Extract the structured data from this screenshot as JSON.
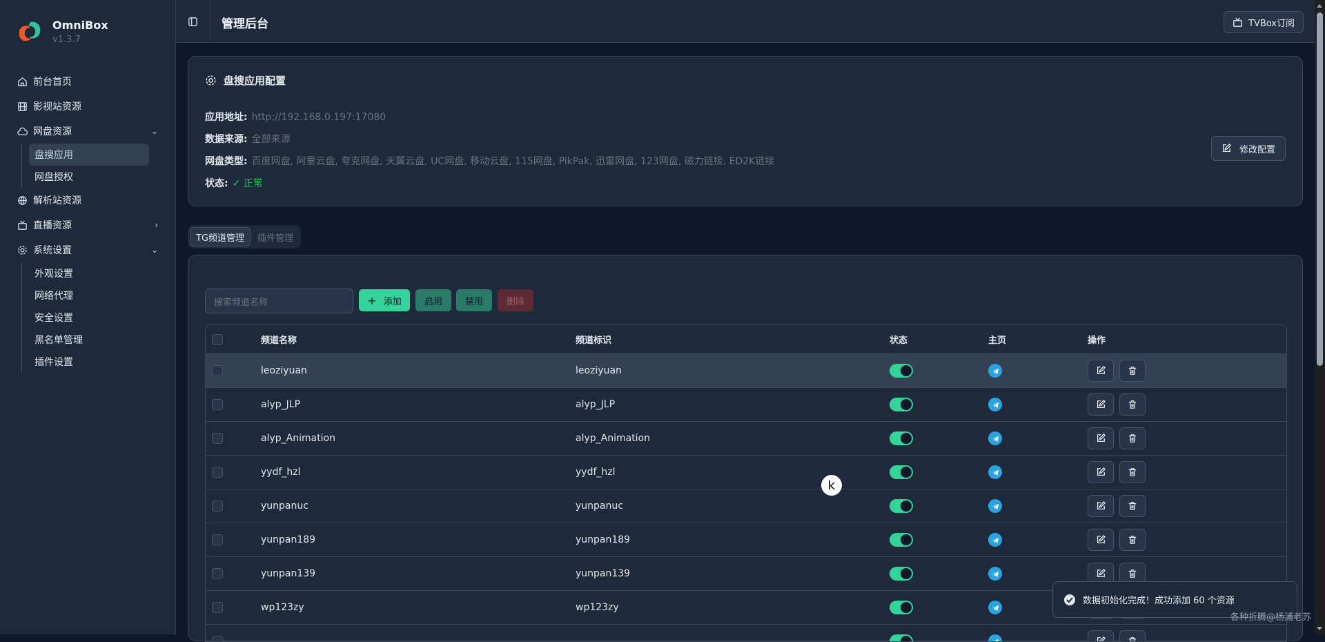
{
  "app": {
    "name": "OmniBox",
    "version": "v1.3.7"
  },
  "sidebar": {
    "items": [
      {
        "label": "前台首页",
        "icon": "home-icon"
      },
      {
        "label": "影视站资源",
        "icon": "film-icon"
      },
      {
        "label": "网盘资源",
        "icon": "cloud-icon",
        "children": [
          {
            "label": "盘搜应用",
            "active": true
          },
          {
            "label": "网盘授权"
          }
        ]
      },
      {
        "label": "解析站资源",
        "icon": "globe-icon"
      },
      {
        "label": "直播资源",
        "icon": "tv-icon"
      },
      {
        "label": "系统设置",
        "icon": "gear-icon",
        "children": [
          {
            "label": "外观设置"
          },
          {
            "label": "网络代理"
          },
          {
            "label": "安全设置"
          },
          {
            "label": "黑名单管理"
          },
          {
            "label": "插件设置"
          }
        ]
      }
    ]
  },
  "header": {
    "title": "管理后台",
    "tvbox_label": "TVBox订阅"
  },
  "config": {
    "title": "盘搜应用配置",
    "address_label": "应用地址:",
    "address": "http://192.168.0.197:17080",
    "source_label": "数据来源:",
    "source": "全部来源",
    "types_label": "网盘类型:",
    "types": "百度网盘, 阿里云盘, 夸克网盘, 天翼云盘, UC网盘, 移动云盘, 115网盘, PikPak, 迅雷网盘, 123网盘, 磁力链接, ED2K链接",
    "status_label": "状态:",
    "status": "正常",
    "edit_label": "修改配置"
  },
  "tabs": [
    {
      "label": "TG频道管理",
      "active": true
    },
    {
      "label": "插件管理"
    }
  ],
  "toolbar": {
    "search_placeholder": "搜索频道名称",
    "add": "添加",
    "enable": "启用",
    "disable": "禁用",
    "delete": "删除"
  },
  "table": {
    "columns": [
      "频道名称",
      "频道标识",
      "状态",
      "主页",
      "操作"
    ],
    "rows": [
      {
        "name": "leoziyuan",
        "id": "leoziyuan",
        "enabled": true
      },
      {
        "name": "alyp_JLP",
        "id": "alyp_JLP",
        "enabled": true
      },
      {
        "name": "alyp_Animation",
        "id": "alyp_Animation",
        "enabled": true
      },
      {
        "name": "yydf_hzl",
        "id": "yydf_hzl",
        "enabled": true
      },
      {
        "name": "yunpanuc",
        "id": "yunpanuc",
        "enabled": true
      },
      {
        "name": "yunpan189",
        "id": "yunpan189",
        "enabled": true
      },
      {
        "name": "yunpan139",
        "id": "yunpan139",
        "enabled": true
      },
      {
        "name": "wp123zy",
        "id": "wp123zy",
        "enabled": true
      },
      {
        "name": "",
        "id": "",
        "enabled": true
      }
    ]
  },
  "toast": "数据初始化完成！成功添加 60 个资源",
  "watermark": "各种折腾@杨浦老苏",
  "cursor": "k",
  "colors": {
    "accent": "#34d399",
    "ok": "#22c55e",
    "telegram": "#2aa3e0",
    "danger": "#5b2a35"
  }
}
